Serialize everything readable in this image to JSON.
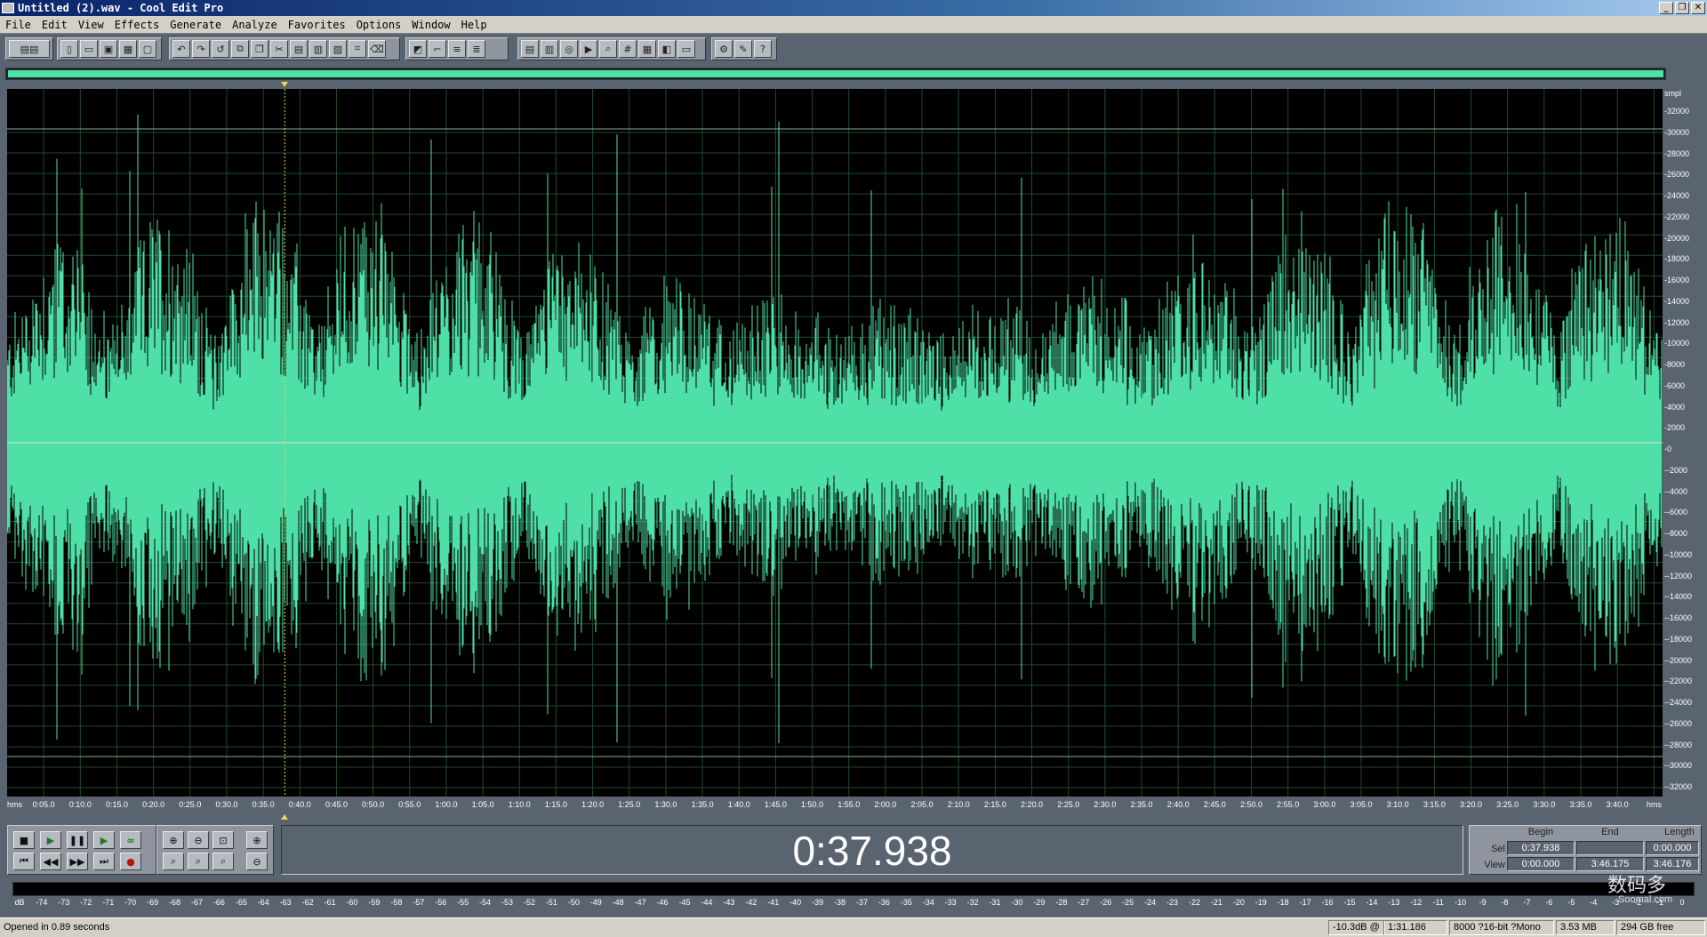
{
  "window": {
    "title": "Untitled (2).wav - Cool Edit Pro",
    "minimize": "_",
    "restore": "❐",
    "close": "✕"
  },
  "menu": [
    "File",
    "Edit",
    "View",
    "Effects",
    "Generate",
    "Analyze",
    "Favorites",
    "Options",
    "Window",
    "Help"
  ],
  "toolbar_icons": {
    "group1": [
      "multitrack-toggle-icon"
    ],
    "group2": [
      "new-icon",
      "open-icon",
      "save-icon",
      "save-all-icon",
      "close-file-icon"
    ],
    "group3": [
      "undo-icon",
      "redo-icon",
      "repeat-icon",
      "copy-new-icon",
      "copy-icon",
      "cut-icon",
      "paste-icon",
      "paste-new-icon",
      "mix-paste-icon",
      "crop-icon",
      "delete-icon"
    ],
    "group4": [
      "spectral-view-icon",
      "envelope-icon",
      "mix-icon",
      "wave-props-icon"
    ],
    "group5": [
      "cue-list-icon",
      "play-list-icon",
      "marker-icon",
      "playback-icon",
      "find-icon",
      "time-format-icon",
      "sample-icon",
      "info-icon",
      "close-icon2"
    ],
    "group6": [
      "settings-icon",
      "scripts-icon",
      "help-icon"
    ]
  },
  "waveform": {
    "color": "#4fe0a8",
    "background": "#000000",
    "grid_color": "#1f4a2a",
    "cursor_time": "0:37.938",
    "total_length_seconds": 226.176
  },
  "amplitude_scale": {
    "unit": "smpl",
    "labels": [
      "32000",
      "30000",
      "28000",
      "26000",
      "24000",
      "22000",
      "20000",
      "18000",
      "16000",
      "14000",
      "12000",
      "10000",
      "8000",
      "6000",
      "4000",
      "2000",
      "0",
      "-2000",
      "-4000",
      "-6000",
      "-8000",
      "-10000",
      "-12000",
      "-14000",
      "-16000",
      "-18000",
      "-20000",
      "-22000",
      "-24000",
      "-26000",
      "-28000",
      "-30000",
      "-32000"
    ]
  },
  "time_ruler": {
    "left_unit": "hms",
    "right_unit": "hms",
    "labels": [
      "0:05.0",
      "0:10.0",
      "0:15.0",
      "0:20.0",
      "0:25.0",
      "0:30.0",
      "0:35.0",
      "0:40.0",
      "0:45.0",
      "0:50.0",
      "0:55.0",
      "1:00.0",
      "1:05.0",
      "1:10.0",
      "1:15.0",
      "1:20.0",
      "1:25.0",
      "1:30.0",
      "1:35.0",
      "1:40.0",
      "1:45.0",
      "1:50.0",
      "1:55.0",
      "2:00.0",
      "2:05.0",
      "2:10.0",
      "2:15.0",
      "2:20.0",
      "2:25.0",
      "2:30.0",
      "2:35.0",
      "2:40.0",
      "2:45.0",
      "2:50.0",
      "2:55.0",
      "3:00.0",
      "3:05.0",
      "3:10.0",
      "3:15.0",
      "3:20.0",
      "3:25.0",
      "3:30.0",
      "3:35.0",
      "3:40.0"
    ]
  },
  "transport": {
    "stop": "■",
    "play": "▶",
    "pause": "❚❚",
    "play_to_end": "▶",
    "loop": "∞",
    "go_start": "⏮",
    "rewind": "◀◀",
    "forward": "▶▶",
    "go_end": "⏭",
    "record": "●"
  },
  "time_display": "0:37.938",
  "selection": {
    "headers": {
      "begin": "Begin",
      "end": "End",
      "length": "Length"
    },
    "sel_label": "Sel",
    "view_label": "View",
    "sel_begin": "0:37.938",
    "sel_end": "",
    "sel_length": "0:00.000",
    "view_begin": "0:00.000",
    "view_end": "3:46.175",
    "view_length": "3:46.176"
  },
  "level_meter": {
    "labels": [
      "dB",
      "-74",
      "-73",
      "-72",
      "-71",
      "-70",
      "-69",
      "-68",
      "-67",
      "-66",
      "-65",
      "-64",
      "-63",
      "-62",
      "-61",
      "-60",
      "-59",
      "-58",
      "-57",
      "-56",
      "-55",
      "-54",
      "-53",
      "-52",
      "-51",
      "-50",
      "-49",
      "-48",
      "-47",
      "-46",
      "-45",
      "-44",
      "-43",
      "-42",
      "-41",
      "-40",
      "-39",
      "-38",
      "-37",
      "-36",
      "-35",
      "-34",
      "-33",
      "-32",
      "-31",
      "-30",
      "-29",
      "-28",
      "-27",
      "-26",
      "-25",
      "-24",
      "-23",
      "-22",
      "-21",
      "-20",
      "-19",
      "-18",
      "-17",
      "-16",
      "-15",
      "-14",
      "-13",
      "-12",
      "-11",
      "-10",
      "-9",
      "-8",
      "-7",
      "-6",
      "-5",
      "-4",
      "-3",
      "-2",
      "-1",
      "0"
    ]
  },
  "status": {
    "message": "Opened in 0.89 seconds",
    "level": "-10.3dB @",
    "position": "1:31.186",
    "format": "8000 ?16-bit ?Mono",
    "size": "3.53 MB",
    "free": "294 GB free"
  },
  "watermark": {
    "text": "数码多",
    "sub": "Soomal.com"
  }
}
